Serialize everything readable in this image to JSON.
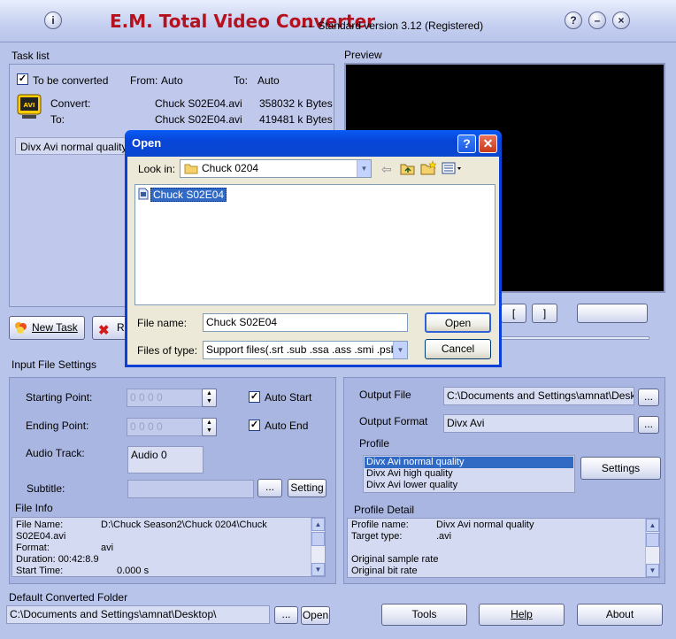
{
  "app": {
    "title": "E.M. Total Video Converter",
    "version": "----   Standard version 3.12 (Registered)",
    "info_glyph": "i",
    "help_glyph": "?",
    "min_glyph": "–",
    "close_glyph": "×"
  },
  "tasklist": {
    "label": "Task list",
    "checkbox_label": "To be converted",
    "check_glyph": "✓",
    "from_label": "From:",
    "from_value": "Auto",
    "to_label": "To:",
    "to_value": "Auto",
    "convert_label": "Convert:",
    "convert_file": "Chuck S02E04.avi",
    "convert_size": "358032 k Bytes",
    "to_row_label": "To:",
    "to_file": "Chuck S02E04.avi",
    "to_size": "419481 k Bytes",
    "profile_item": "Divx Avi normal quality",
    "avi_icon": "AVI"
  },
  "toolbar": {
    "new_task": "New Task",
    "remove_partial": "R"
  },
  "preview": {
    "label": "Preview",
    "bracket_open": "[",
    "bracket_close": "]"
  },
  "input_settings": {
    "label": "Input File Settings",
    "starting_point": "Starting Point:",
    "ending_point": "Ending Point:",
    "time_digits": "0    0    0    0",
    "auto_start": "Auto Start",
    "auto_end": "Auto End",
    "audio_track_label": "Audio Track:",
    "audio_track_value": "Audio 0",
    "subtitle_label": "Subtitle:",
    "subtitle_browse": "...",
    "subtitle_setting": "Setting"
  },
  "file_info": {
    "label": "File Info",
    "rows": [
      {
        "k": "File Name:",
        "v": "D:\\Chuck Season2\\Chuck 0204\\Chuck"
      },
      {
        "k": "S02E04.avi",
        "v": ""
      },
      {
        "k": "Format:",
        "v": "avi"
      },
      {
        "k": "Duration:  00:42:8.9",
        "v": ""
      },
      {
        "k": "Start Time:",
        "v": "0.000   s"
      }
    ]
  },
  "output": {
    "file_label": "Output File",
    "file_value": "C:\\Documents and Settings\\amnat\\Desktop\\",
    "file_browse": "...",
    "format_label": "Output Format",
    "format_value": "Divx Avi",
    "format_browse": "...",
    "profile_label": "Profile",
    "profiles": [
      "Divx Avi normal quality",
      "Divx Avi high quality",
      "Divx Avi lower quality"
    ],
    "settings_button": "Settings",
    "detail_label": "Profile Detail",
    "detail_rows": [
      {
        "k": "Profile name:",
        "v": "Divx Avi normal quality"
      },
      {
        "k": "Target type:",
        "v": ".avi"
      },
      {
        "k": "",
        "v": ""
      },
      {
        "k": "Original sample rate",
        "v": ""
      },
      {
        "k": "Original bit rate",
        "v": ""
      }
    ]
  },
  "default_folder": {
    "label": "Default Converted Folder",
    "value": "C:\\Documents and Settings\\amnat\\Desktop\\",
    "browse": "...",
    "open": "Open"
  },
  "bottom_buttons": {
    "tools": "Tools",
    "help": "Help",
    "about": "About"
  },
  "open_dialog": {
    "title": "Open",
    "help_glyph": "?",
    "close_glyph": "✕",
    "look_in_label": "Look in:",
    "look_in_value": "Chuck 0204",
    "files": [
      "Chuck S02E04"
    ],
    "file_name_label": "File name:",
    "file_name_value": "Chuck S02E04",
    "files_of_type_label": "Files of type:",
    "files_of_type_value": "Support files(.srt .sub .ssa .ass .smi .psb .txt .",
    "open_button": "Open",
    "cancel_button": "Cancel",
    "arrow_glyph": "▼"
  },
  "colors": {
    "title_red": "#b3121e",
    "xp_blue": "#0a46cf",
    "selection": "#316ac5"
  }
}
